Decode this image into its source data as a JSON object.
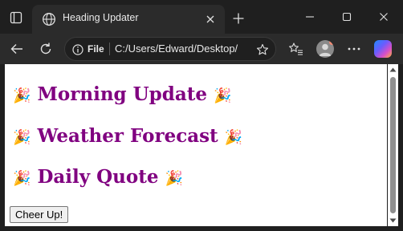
{
  "browser": {
    "tab_title": "Heading Updater",
    "address": {
      "scheme_label": "File",
      "url": "C:/Users/Edward/Desktop/"
    }
  },
  "page": {
    "headings": [
      {
        "text": "Morning Update"
      },
      {
        "text": "Weather Forecast"
      },
      {
        "text": "Daily Quote"
      }
    ],
    "decoration_emoji": "🎉",
    "button_label": "Cheer Up!"
  },
  "colors": {
    "heading": "#800080",
    "chrome_dark": "#1f1f1f",
    "toolbar": "#2b2b2b"
  },
  "icons": [
    "tab-actions-icon",
    "globe-icon",
    "close-icon",
    "plus-icon",
    "minimize-icon",
    "maximize-icon",
    "window-close-icon",
    "back-icon",
    "refresh-icon",
    "info-icon",
    "star-icon",
    "favorites-icon",
    "profile-icon",
    "more-icon",
    "copilot-icon"
  ]
}
